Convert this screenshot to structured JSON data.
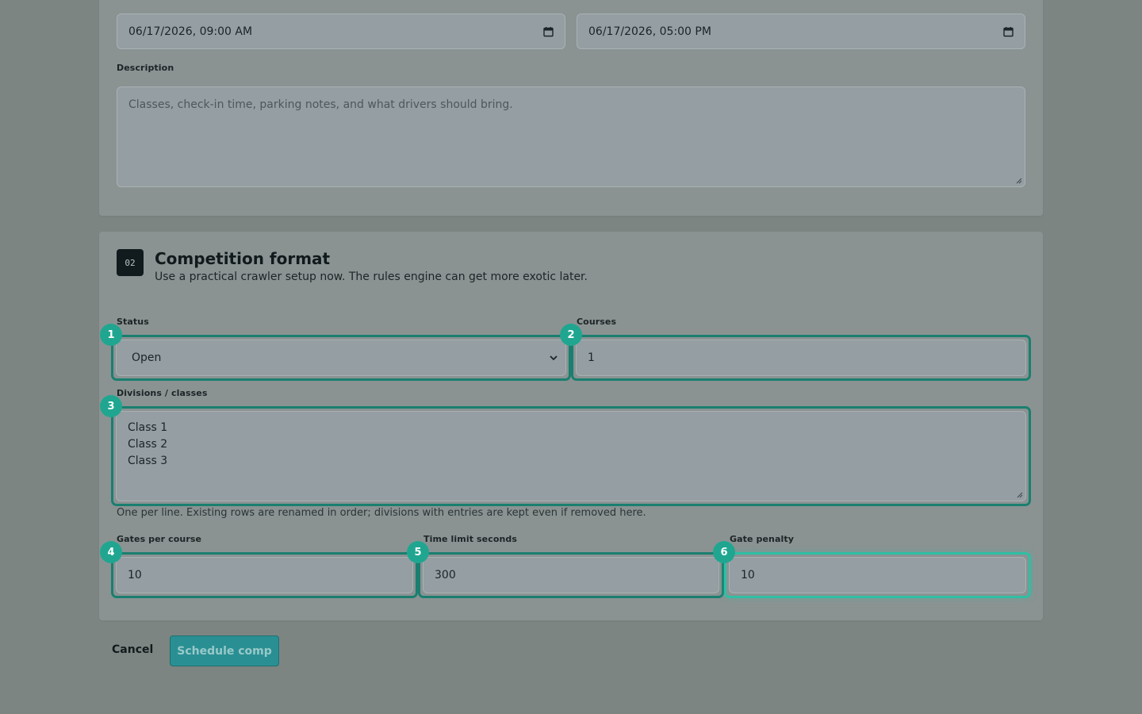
{
  "event": {
    "start": "06/17/2026, 09:00 AM",
    "end": "06/17/2026, 05:00 PM",
    "description_label": "Description",
    "description_placeholder": "Classes, check-in time, parking notes, and what drivers should bring.",
    "description_value": ""
  },
  "format": {
    "step": "02",
    "title": "Competition format",
    "subtitle": "Use a practical crawler setup now. The rules engine can get more exotic later.",
    "status_label": "Status",
    "status_value": "Open",
    "courses_label": "Courses",
    "courses_value": "1",
    "divisions_label": "Divisions / classes",
    "divisions": [
      "Class 1",
      "Class 2",
      "Class 3"
    ],
    "divisions_hint": "One per line. Existing rows are renamed in order; divisions with entries are kept even if removed here.",
    "gates_label": "Gates per course",
    "gates_value": "10",
    "time_label": "Time limit seconds",
    "time_value": "300",
    "penalty_label": "Gate penalty",
    "penalty_value": "10"
  },
  "markers": [
    "1",
    "2",
    "3",
    "4",
    "5",
    "6"
  ],
  "actions": {
    "cancel": "Cancel",
    "submit": "Schedule comp"
  },
  "colors": {
    "accent": "#20a690",
    "highlight": "#1a7f70",
    "primary_button": "#2a8f93"
  }
}
